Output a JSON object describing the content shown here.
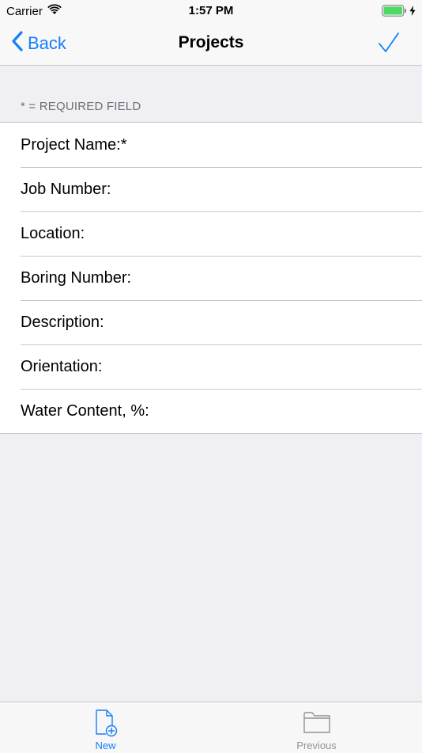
{
  "status_bar": {
    "carrier": "Carrier",
    "time": "1:57 PM",
    "battery_level": 1.0,
    "icons": [
      "wifi-icon",
      "battery-icon",
      "charging-bolt-icon"
    ]
  },
  "nav": {
    "back_label": "Back",
    "title": "Projects",
    "done_icon": "checkmark-icon",
    "accent_color": "#157efb"
  },
  "form": {
    "section_header": "* = REQUIRED FIELD",
    "fields": [
      {
        "label": "Project Name:*"
      },
      {
        "label": "Job Number:"
      },
      {
        "label": "Location:"
      },
      {
        "label": "Boring Number:"
      },
      {
        "label": "Description:"
      },
      {
        "label": "Orientation:"
      },
      {
        "label": "Water Content, %:"
      }
    ]
  },
  "tab_bar": {
    "tabs": [
      {
        "label": "New",
        "icon": "new-document-icon",
        "selected": true
      },
      {
        "label": "Previous",
        "icon": "folder-icon",
        "selected": false
      }
    ]
  }
}
